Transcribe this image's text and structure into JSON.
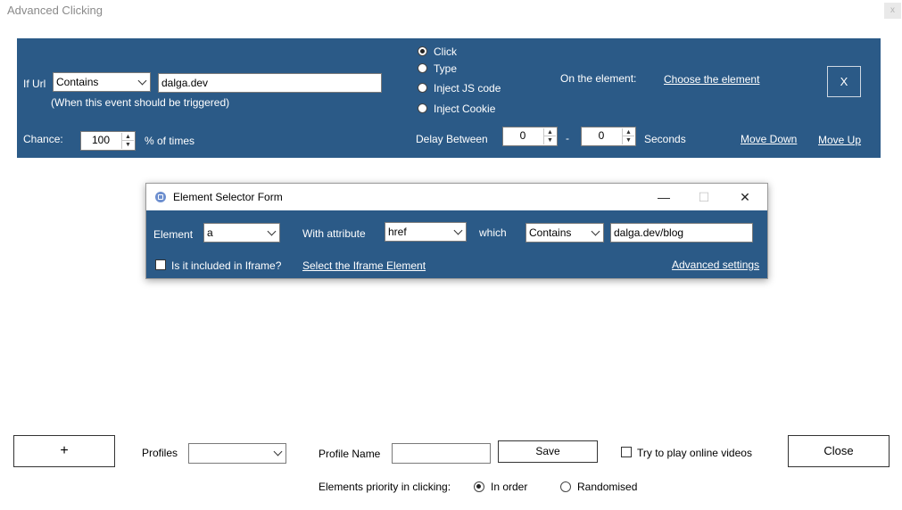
{
  "window": {
    "title": "Advanced Clicking",
    "close_glyph": "x"
  },
  "trigger": {
    "if_url_label": "If Url",
    "url_match": "Contains",
    "url_value": "dalga.dev",
    "hint": "(When this event should be triggered)",
    "chance_label": "Chance:",
    "chance_value": "100",
    "chance_suffix": "% of times"
  },
  "actions": {
    "options": [
      {
        "label": "Click",
        "selected": true
      },
      {
        "label": "Type",
        "selected": false
      },
      {
        "label": "Inject JS code",
        "selected": false
      },
      {
        "label": "Inject Cookie",
        "selected": false
      }
    ]
  },
  "element_section": {
    "label": "On the element:",
    "choose_link": "Choose the element"
  },
  "delay": {
    "label": "Delay Between",
    "from": "0",
    "separator": "-",
    "to": "0",
    "unit": "Seconds"
  },
  "move": {
    "down": "Move Down",
    "up": "Move Up"
  },
  "remove_button": "X",
  "dialog": {
    "title": "Element Selector Form",
    "minimize": "—",
    "maximize": "☐",
    "close": "✕",
    "element_label": "Element",
    "element_value": "a",
    "attribute_label": "With attribute",
    "attribute_value": "href",
    "which_label": "which",
    "match_value": "Contains",
    "match_text": "dalga.dev/blog",
    "iframe_label": "Is it included in Iframe?",
    "iframe_link": "Select the Iframe Element",
    "advanced_link": "Advanced settings"
  },
  "footer": {
    "add_button": "+",
    "profiles_label": "Profiles",
    "profiles_value": "",
    "profile_name_label": "Profile Name",
    "profile_name_value": "",
    "save_button": "Save",
    "videos_label": "Try to play online videos",
    "close_button": "Close",
    "priority_label": "Elements priority in clicking:",
    "priority_in_order": "In order",
    "priority_random": "Randomised"
  }
}
